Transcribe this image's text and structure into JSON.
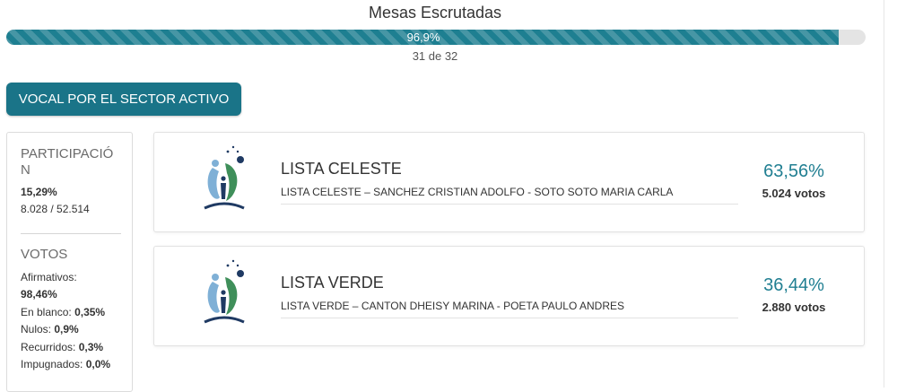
{
  "progress": {
    "title": "Mesas Escrutadas",
    "percent_label": "96,9%",
    "fraction": 0.969,
    "count_label": "31 de 32",
    "fill_color": "#1e7f91",
    "track_color": "#e4e4e4"
  },
  "sector_button": {
    "label": "VOCAL POR EL SECTOR ACTIVO",
    "color": "#1a7488"
  },
  "participation": {
    "title_line1": "PARTICIPACIÓ",
    "title_line2": "N",
    "percent": "15,29%",
    "ratio": "8.028 / 52.514"
  },
  "votes_summary": {
    "title": "VOTOS",
    "afirmativos_label": "Afirmativos:",
    "afirmativos_value": "98,46%",
    "blanco_label": "En blanco:",
    "blanco_value": "0,35%",
    "nulos_label": "Nulos:",
    "nulos_value": "0,9%",
    "recurridos_label": "Recurridos:",
    "recurridos_value": "0,3%",
    "impugnados_label": "Impugnados:",
    "impugnados_value": "0,0%"
  },
  "lists": [
    {
      "name": "LISTA CELESTE",
      "members": "LISTA CELESTE – SANCHEZ CRISTIAN ADOLFO - SOTO SOTO MARIA CARLA",
      "percent": "63,56%",
      "votes": "5.024 votos",
      "logo_icon": "people-logo-icon"
    },
    {
      "name": "LISTA VERDE",
      "members": "LISTA VERDE – CANTON DHEISY MARINA - POETA PAULO ANDRES",
      "percent": "36,44%",
      "votes": "2.880 votos",
      "logo_icon": "people-logo-icon"
    }
  ],
  "colors": {
    "accent": "#217f92",
    "logo_blue": "#7fb0d6",
    "logo_green": "#3f8f5a",
    "logo_navy": "#1f3a63"
  }
}
